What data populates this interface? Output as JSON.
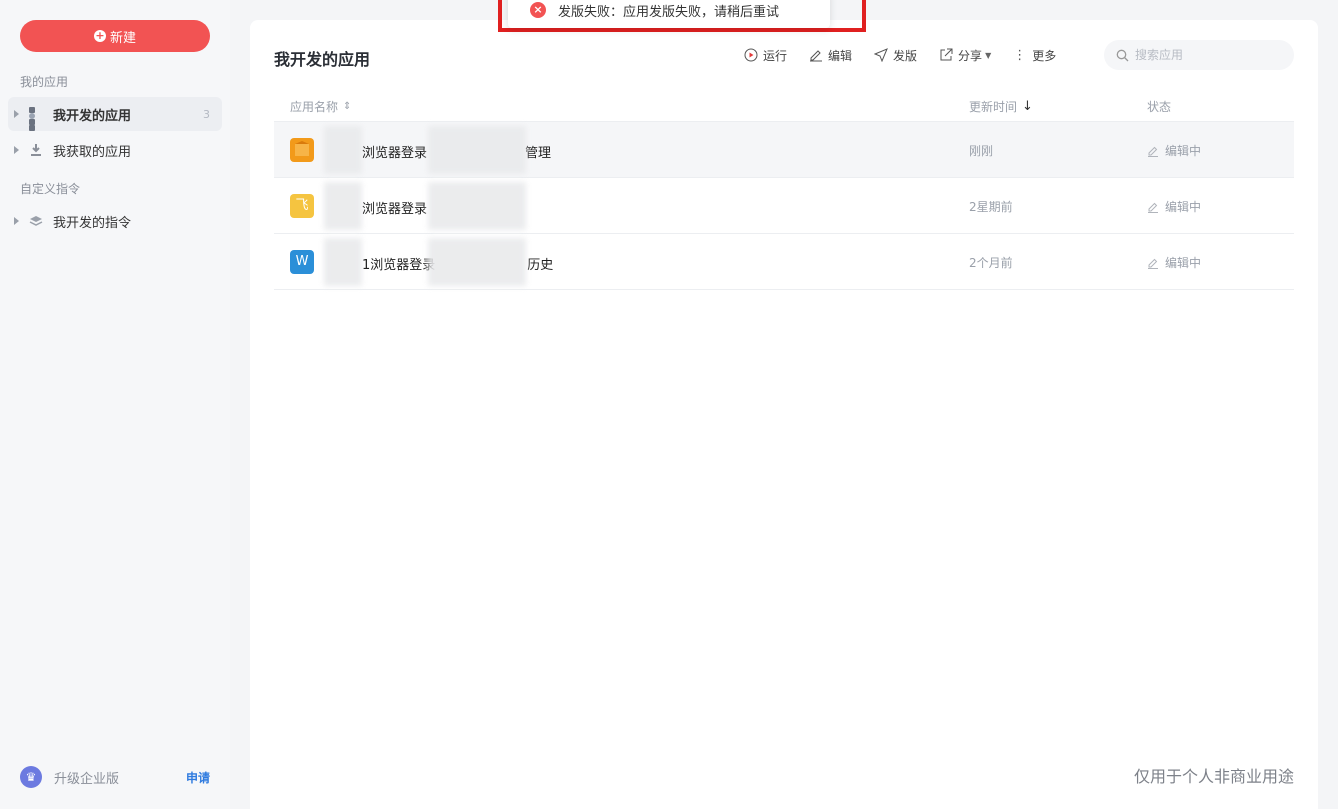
{
  "sidebar": {
    "new_button": "新建",
    "sections": [
      {
        "label": "我的应用"
      },
      {
        "label": "自定义指令"
      }
    ],
    "items": [
      {
        "label": "我开发的应用",
        "count": "3"
      },
      {
        "label": "我获取的应用"
      },
      {
        "label": "我开发的指令"
      }
    ],
    "upgrade": {
      "label": "升级企业版",
      "apply": "申请"
    }
  },
  "main": {
    "title": "我开发的应用",
    "toolbar": {
      "run": "运行",
      "edit": "编辑",
      "publish": "发版",
      "share": "分享",
      "more": "更多"
    },
    "search": {
      "placeholder": "搜索应用"
    },
    "columns": {
      "name": "应用名称",
      "updated": "更新时间",
      "status": "状态"
    },
    "rows": [
      {
        "icon": "box-icon",
        "icon_color": "#f29a1a",
        "name_visible": "浏览器登录",
        "name_suffix": "管理",
        "updated": "刚刚",
        "status": "编辑中"
      },
      {
        "icon": "fei-icon",
        "icon_char": "飞",
        "icon_color": "#f5c440",
        "name_visible": "浏览器登录",
        "name_suffix": "",
        "updated": "2星期前",
        "status": "编辑中"
      },
      {
        "icon": "word-icon",
        "icon_char": "W",
        "icon_color": "#2b8fd8",
        "name_visible": "1浏览器登录",
        "name_suffix": "历史",
        "updated": "2个月前",
        "status": "编辑中"
      }
    ]
  },
  "toast": {
    "message": "发版失败：应用发版失败，请稍后重试"
  },
  "watermark": "仅用于个人非商业用途"
}
